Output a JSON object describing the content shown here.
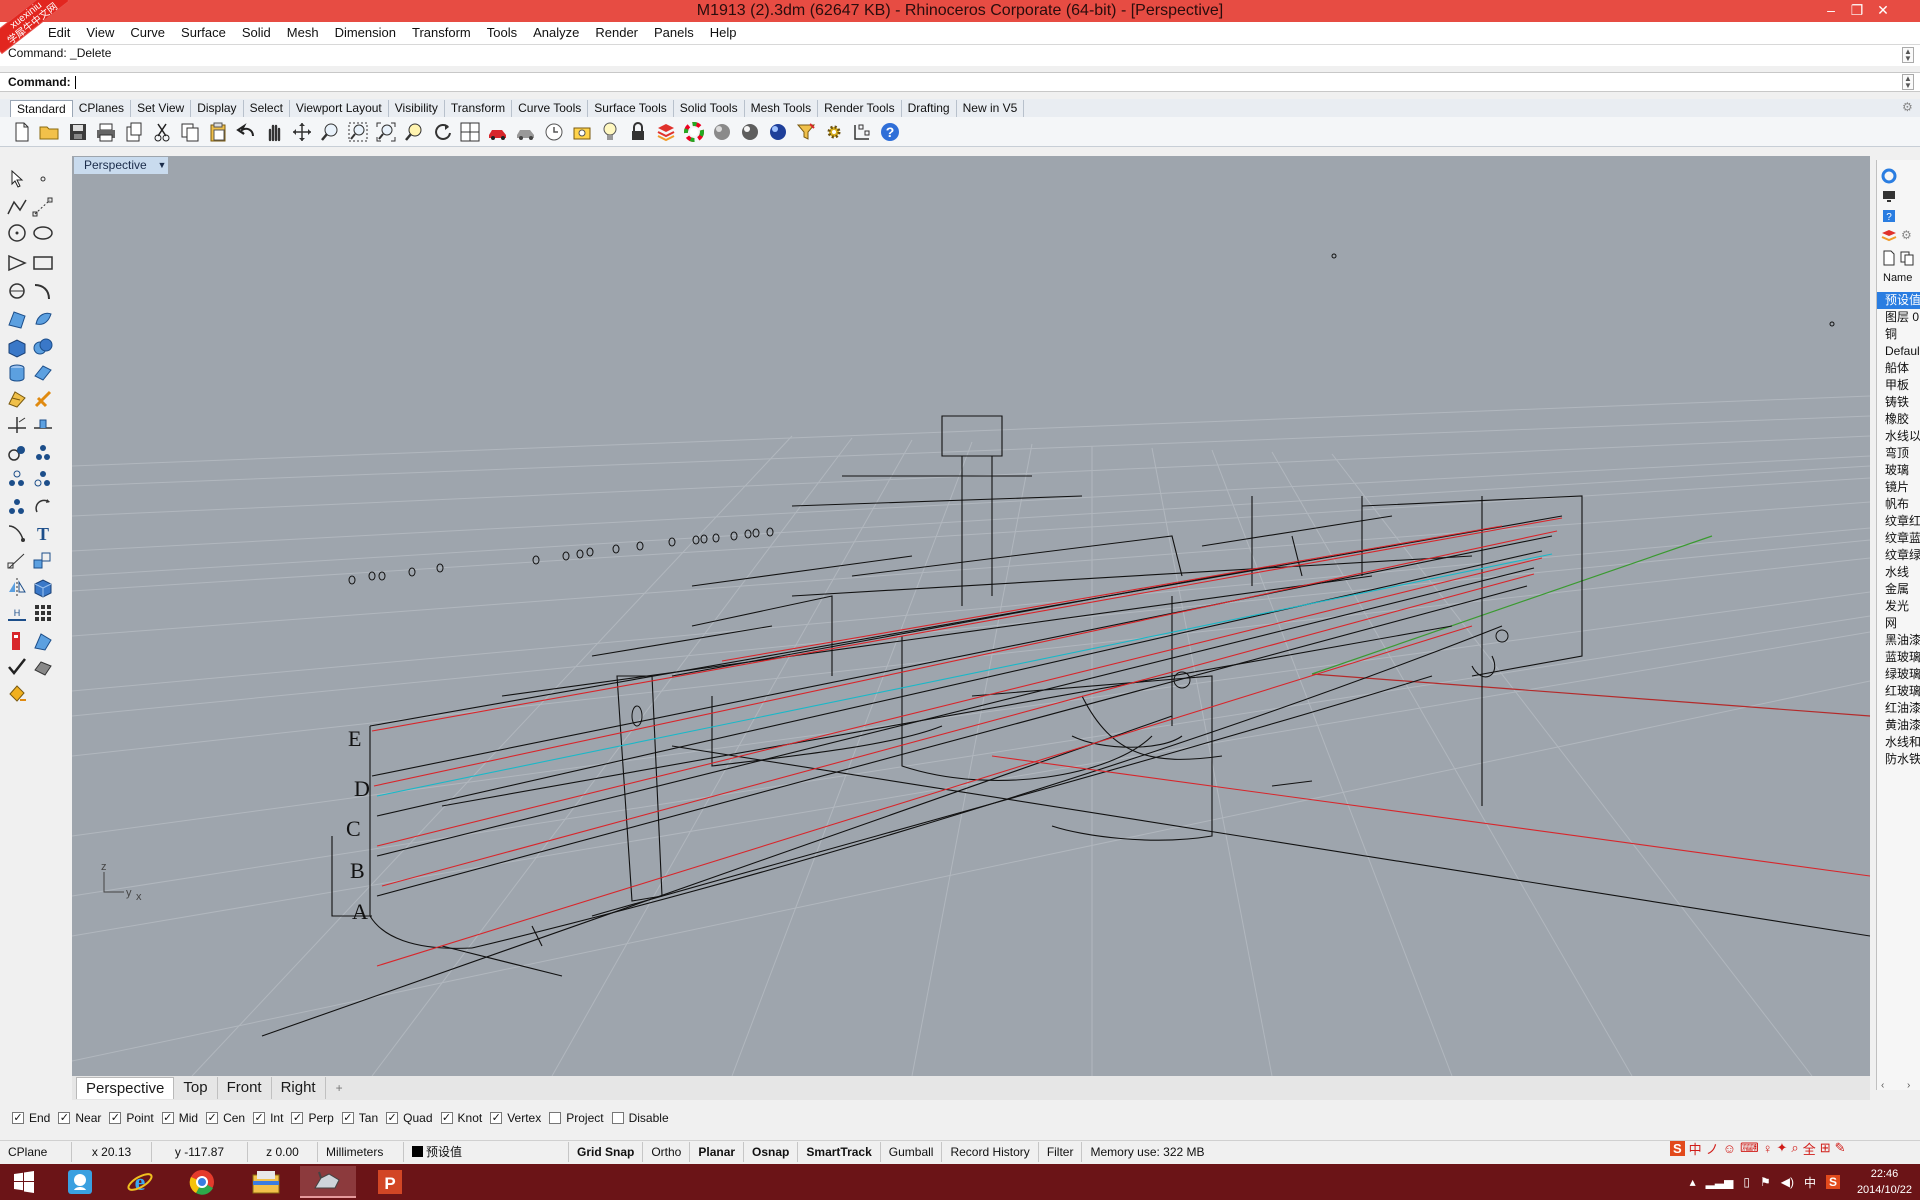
{
  "window": {
    "title": "M1913 (2).3dm (62647 KB) - Rhinoceros Corporate (64-bit) - [Perspective]",
    "corner_ribbon_text_1": "xuexiniu",
    "corner_ribbon_text_2": "学犀牛中文网"
  },
  "menu": [
    "Edit",
    "View",
    "Curve",
    "Surface",
    "Solid",
    "Mesh",
    "Dimension",
    "Transform",
    "Tools",
    "Analyze",
    "Render",
    "Panels",
    "Help"
  ],
  "command": {
    "history": "Command: _Delete",
    "prompt": "Command:"
  },
  "toolbar_tabs": [
    "Standard",
    "CPlanes",
    "Set View",
    "Display",
    "Select",
    "Viewport Layout",
    "Visibility",
    "Transform",
    "Curve Tools",
    "Surface Tools",
    "Solid Tools",
    "Mesh Tools",
    "Render Tools",
    "Drafting",
    "New in V5"
  ],
  "toolbar_icons": [
    "new-icon",
    "open-icon",
    "save-icon",
    "print-icon",
    "import-icon",
    "cut-icon",
    "copy-icon",
    "paste-icon",
    "undo-icon",
    "pan-hand-icon",
    "move-view-icon",
    "zoom-in-icon",
    "zoom-window-icon",
    "zoom-extents-icon",
    "zoom-selected-icon",
    "rotate-view-icon",
    "four-viewports-icon",
    "car-icon",
    "named-view-icon",
    "clock-icon",
    "snapshot-icon",
    "light-icon",
    "lock-icon",
    "layer-icon",
    "color-wheel-icon",
    "shaded-sphere-icon",
    "rendered-sphere-icon",
    "blue-sphere-icon",
    "filter-icon",
    "options-gear-icon",
    "dimension-icon",
    "help-icon"
  ],
  "viewport": {
    "label": "Perspective",
    "hull_labels": [
      "E",
      "D",
      "C",
      "B",
      "A"
    ],
    "axis_z": "z",
    "axis_y": "y",
    "axis_x": "x"
  },
  "viewport_tabs": [
    "Perspective",
    "Top",
    "Front",
    "Right"
  ],
  "viewport_tab_add": "+",
  "right_panel": {
    "name_header": "Name",
    "layers": [
      "预设值",
      "图层 0",
      "铜",
      "Default",
      "船体",
      "甲板",
      "铸铁",
      "橡胶",
      "水线以",
      "弯顶",
      "玻璃",
      "镜片",
      "帆布",
      "纹章红",
      "纹章蓝",
      "纹章绿",
      "水线",
      "金属",
      "发光",
      "网",
      "黑油漆",
      "蓝玻璃",
      "绿玻璃",
      "红玻璃",
      "红油漆",
      "黄油漆",
      "水线和",
      "防水铁"
    ],
    "selected_index": 0
  },
  "osnap": [
    {
      "label": "End",
      "checked": true
    },
    {
      "label": "Near",
      "checked": true
    },
    {
      "label": "Point",
      "checked": true
    },
    {
      "label": "Mid",
      "checked": true
    },
    {
      "label": "Cen",
      "checked": true
    },
    {
      "label": "Int",
      "checked": true
    },
    {
      "label": "Perp",
      "checked": true
    },
    {
      "label": "Tan",
      "checked": true
    },
    {
      "label": "Quad",
      "checked": true
    },
    {
      "label": "Knot",
      "checked": true
    },
    {
      "label": "Vertex",
      "checked": true
    },
    {
      "label": "Project",
      "checked": false
    },
    {
      "label": "Disable",
      "checked": false
    }
  ],
  "status": {
    "cplane": "CPlane",
    "x": "x 20.13",
    "y": "y -117.87",
    "z": "z 0.00",
    "units": "Millimeters",
    "layer": "预设值",
    "grid_snap": "Grid Snap",
    "ortho": "Ortho",
    "planar": "Planar",
    "osnap": "Osnap",
    "smarttrack": "SmartTrack",
    "gumball": "Gumball",
    "record_history": "Record History",
    "filter": "Filter",
    "memory": "Memory use: 322 MB"
  },
  "ime_bar": [
    "S",
    "中",
    "ノ",
    "☺",
    "⌨",
    "♀",
    "✦",
    "⌕",
    "全",
    "⊞",
    "✎"
  ],
  "taskbar": {
    "apps": [
      "start-icon",
      "qq-icon",
      "ie-icon",
      "chrome-icon",
      "explorer-icon",
      "rhino-icon",
      "powerpoint-icon"
    ],
    "tray_lang": "中",
    "time": "22:46",
    "date": "2014/10/22"
  },
  "colors": {
    "title_bar": "#e74c43",
    "viewport_bg": "#9ea5ad",
    "taskbar": "#6b1417",
    "selected_layer": "#2a7de1"
  }
}
